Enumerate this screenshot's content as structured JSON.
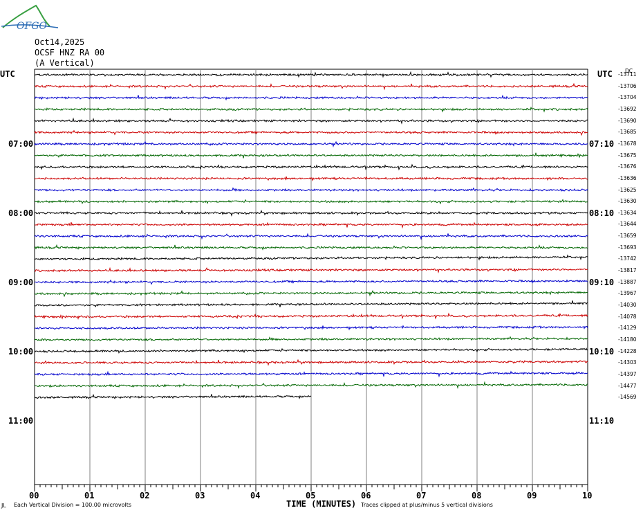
{
  "header": {
    "logo_text": "OFGO",
    "date": "Oct14,2025",
    "station": "OCSF HNZ RA 00",
    "component": "(A Vertical)",
    "left_axis_title": "UTC",
    "right_axis_title": "UTC",
    "dc_label": "DC"
  },
  "footer": {
    "mark": "JL",
    "scale_text": "Each Vertical Division =  100.00 microvolts",
    "xlabel": "TIME (MINUTES)",
    "clip_text": "Traces clipped at plus/minus 5 vertical divisions"
  },
  "colors": {
    "trace_cycle": [
      "#000000",
      "#cc0000",
      "#0000cc",
      "#006600"
    ],
    "grid": "#808080",
    "logo_blue": "#2d6db5",
    "logo_green": "#3aa043"
  },
  "chart_data": {
    "type": "line",
    "title": "OCSF HNZ RA 00 (A Vertical)",
    "xlabel": "TIME (MINUTES)",
    "x_range": [
      0,
      10
    ],
    "x_ticks": [
      "00",
      "01",
      "02",
      "03",
      "04",
      "05",
      "06",
      "07",
      "08",
      "09",
      "10"
    ],
    "left_time_labels": [
      "07:00",
      "08:00",
      "09:00",
      "10:00",
      "11:00"
    ],
    "right_time_labels": [
      "07:10",
      "08:10",
      "09:10",
      "10:10",
      "11:10"
    ],
    "dc_offsets": [
      "-13711",
      "-13706",
      "-13704",
      "-13692",
      "-13690",
      "-13685",
      "-13678",
      "-13675",
      "-13676",
      "-13636",
      "-13625",
      "-13630",
      "-13634",
      "-13644",
      "-13659",
      "-13693",
      "-13742",
      "-13817",
      "-13887",
      "-13967",
      "-14030",
      "-14078",
      "-14129",
      "-14180",
      "-14228",
      "-14303",
      "-14397",
      "-14477",
      "-14569"
    ],
    "trace_count": 29,
    "last_trace_end_minute": 5,
    "vertical_division_microvolts": 100.0,
    "clip_divisions": 5
  }
}
